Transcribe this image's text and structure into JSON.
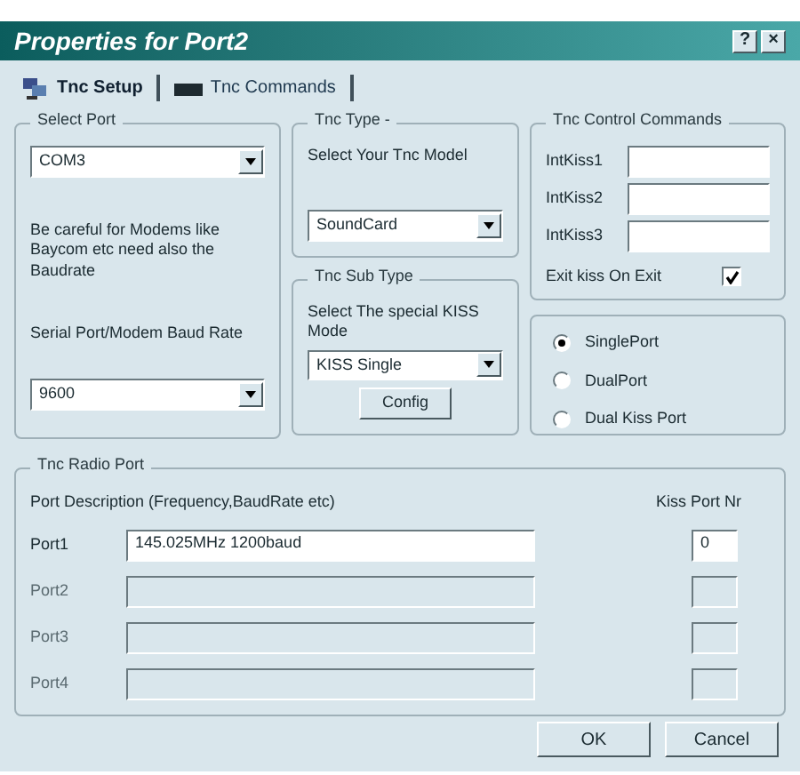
{
  "window": {
    "title": "Properties for Port2"
  },
  "title_buttons": [
    "?",
    "×"
  ],
  "tabs": [
    {
      "label": "Tnc Setup",
      "selected": true
    },
    {
      "label": "Tnc Commands",
      "selected": false
    }
  ],
  "select_port": {
    "title": "Select Port",
    "value": "COM3",
    "note": "Be careful for Modems like Baycom etc need also the Baudrate",
    "baud_label": "Serial Port/Modem Baud Rate",
    "baud_value": "9600"
  },
  "tnc_type": {
    "title": "Tnc Type -",
    "subtitle": "Select Your Tnc Model",
    "value": "SoundCard"
  },
  "tnc_sub_type": {
    "title": "Tnc Sub Type",
    "subtitle": "Select The special KISS Mode",
    "value": "KISS Single",
    "button": "Config"
  },
  "control": {
    "title": "Tnc Control Commands",
    "fields": [
      {
        "label": "IntKiss1"
      },
      {
        "label": "IntKiss2"
      },
      {
        "label": "IntKiss3"
      }
    ],
    "exit_label": "Exit kiss On Exit",
    "exit_checked": true,
    "modes": [
      {
        "label": "SinglePort",
        "selected": true
      },
      {
        "label": "DualPort",
        "selected": false
      },
      {
        "label": "Dual Kiss Port",
        "selected": false
      }
    ]
  },
  "radio_port": {
    "title": "Tnc Radio Port",
    "description_header": "Port Description (Frequency,BaudRate etc)",
    "number_header": "Kiss Port Nr",
    "ports": [
      {
        "label": "Port1",
        "description": "145.025MHz 1200baud",
        "number": "0",
        "disabled": false
      },
      {
        "label": "Port2",
        "disabled": true
      },
      {
        "label": "Port3",
        "disabled": true
      },
      {
        "label": "Port4",
        "disabled": true
      }
    ]
  },
  "buttons": [
    "OK",
    "Cancel"
  ]
}
